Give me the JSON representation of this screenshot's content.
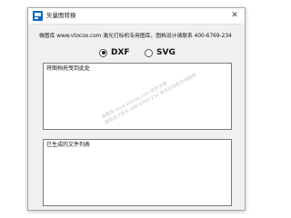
{
  "window": {
    "title": "矢量图转换",
    "close_symbol": "✕"
  },
  "info_text": "做图库 www.vtocoo.com 激光打标机专用图库，图档设计请联系 400-6769-234",
  "format_options": [
    {
      "label": "DXF",
      "selected": true
    },
    {
      "label": "SVG",
      "selected": false
    }
  ],
  "drop_area": {
    "placeholder": "将图档拖曳到此处"
  },
  "file_list": {
    "placeholder": "已生成的文件列表"
  },
  "watermark": {
    "line1": "做图库 www.vtocoo.com 软件分享",
    "line2": "图档设计联系 400-6769-234 激光打标机专用图库"
  },
  "colors": {
    "accent": "#1565c0",
    "window_bg": "#f0f0f0"
  }
}
